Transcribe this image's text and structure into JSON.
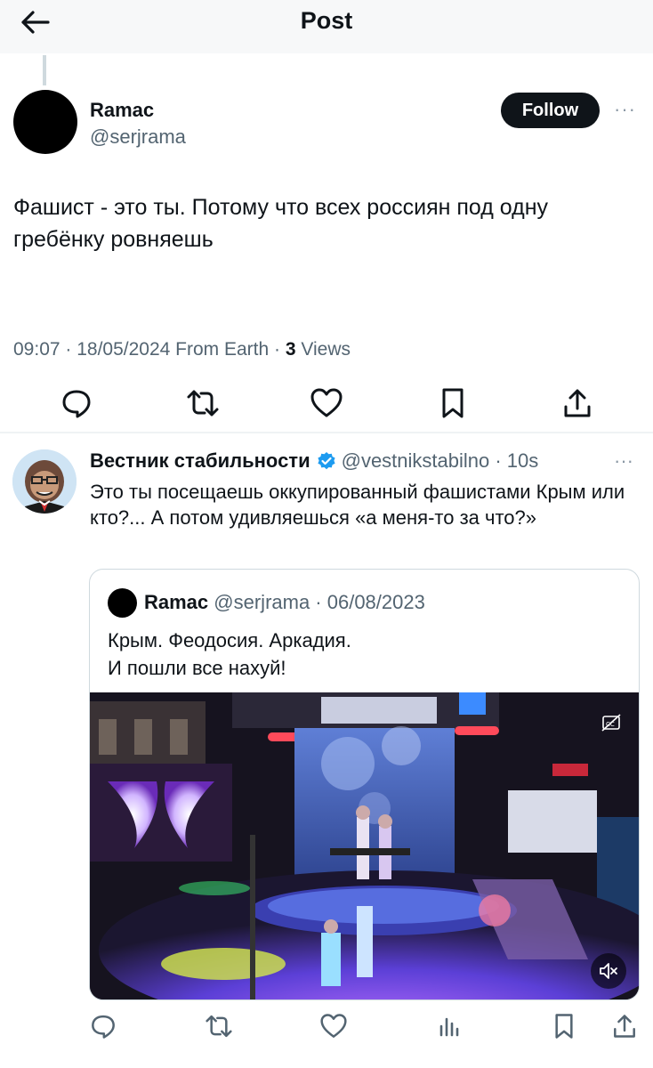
{
  "header": {
    "title": "Post",
    "back_icon": "arrow-left-icon"
  },
  "main_post": {
    "author_name": "Ramac",
    "author_handle": "@serjrama",
    "follow_label": "Follow",
    "more_label": "···",
    "text": "Фашист - это ты. Потому что всех россиян под одну гребёнку ровняешь",
    "meta_prefix": "09:07 · 18/05/2024 From Earth · ",
    "views_count": "3",
    "views_label": " Views",
    "actions": [
      "reply-icon",
      "repost-icon",
      "like-icon",
      "bookmark-icon",
      "share-icon"
    ]
  },
  "reply": {
    "author_name": "Вестник стабильности",
    "verified_color": "#1d9bf0",
    "author_handle_time": "@vestnikstabilno · 10s",
    "more_label": "···",
    "text": "Это ты посещаешь оккупированный фашистами Крым или кто?... А потом удивляешься «а меня-то за что?»",
    "quote": {
      "author_name": "Ramac",
      "author_meta": "@serjrama · 06/08/2023",
      "line1": "Крым. Феодосия. Аркадия.",
      "line2": "И пошли все нахуй!"
    },
    "actions": [
      "reply-icon",
      "repost-icon",
      "like-icon",
      "views-icon",
      "bookmark-icon",
      "share-icon"
    ]
  },
  "colors": {
    "text": "#0f1419",
    "secondary": "#536471",
    "accent": "#1d9bf0"
  }
}
